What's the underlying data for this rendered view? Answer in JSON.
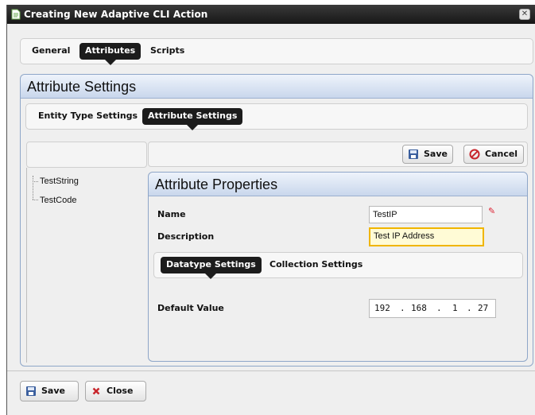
{
  "window": {
    "title": "Creating New Adaptive CLI Action",
    "icon": "document-icon",
    "close_glyph": "✕"
  },
  "main_tabs": [
    {
      "label": "General",
      "active": false
    },
    {
      "label": "Attributes",
      "active": true
    },
    {
      "label": "Scripts",
      "active": false
    }
  ],
  "attribute_settings": {
    "title": "Attribute Settings",
    "tabs": [
      {
        "label": "Entity Type Settings",
        "active": false
      },
      {
        "label": "Attribute Settings",
        "active": true
      }
    ]
  },
  "tree": {
    "items": [
      {
        "label": "TestString"
      },
      {
        "label": "TestCode"
      }
    ]
  },
  "toolbar": {
    "save_label": "Save",
    "cancel_label": "Cancel"
  },
  "attribute_properties": {
    "title": "Attribute Properties",
    "name_label": "Name",
    "name_value": "TestIP",
    "description_label": "Description",
    "description_value": "Test IP Address",
    "sub_tabs": [
      {
        "label": "Datatype Settings",
        "active": true
      },
      {
        "label": "Collection Settings",
        "active": false
      }
    ],
    "default_value_label": "Default Value",
    "ip_octets": [
      "192",
      "168",
      "1",
      "27"
    ]
  },
  "footer": {
    "save_label": "Save",
    "close_label": "Close"
  },
  "colors": {
    "titlebar": "#1f1f1f",
    "panel_header": "#c9d7ec",
    "active_tab": "#1c1c1c",
    "focus_border": "#f0b500",
    "cancel_icon": "#c8262c",
    "close_icon": "#c8262c",
    "save_icon": "#3b5f9e"
  }
}
